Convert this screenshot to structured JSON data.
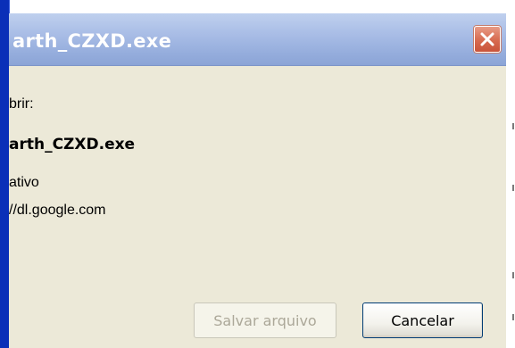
{
  "dialog": {
    "title": "arth_CZXD.exe",
    "open_label": "brir:",
    "file_name": "arth_CZXD.exe",
    "file_type": "ativo",
    "source": "//dl.google.com"
  },
  "buttons": {
    "save_label": "Salvar arquivo",
    "cancel_label": "Cancelar"
  },
  "icons": {
    "close": "close-icon"
  },
  "colors": {
    "title_bar": "#a9bde6",
    "window_body": "#ece9d8",
    "close_button": "#d76a4f",
    "frame_left": "#0a2fb8"
  }
}
